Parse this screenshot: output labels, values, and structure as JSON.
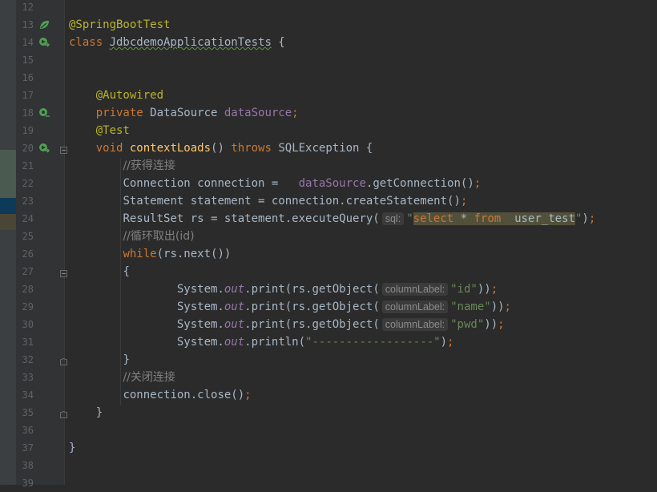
{
  "editor": {
    "lines": [
      {
        "num": "12",
        "tokens": []
      },
      {
        "num": "13",
        "gutter": "spring-bean-icon",
        "tokens": [
          {
            "t": "@SpringBootTest",
            "c": "ann"
          }
        ]
      },
      {
        "num": "14",
        "gutter": "run-test-class-icon",
        "tokens": [
          {
            "t": "class ",
            "c": "kw"
          },
          {
            "t": "JdbcdemoApplicationTests",
            "c": "squig"
          },
          {
            "t": " {",
            "c": "pl"
          }
        ]
      },
      {
        "num": "15",
        "tokens": []
      },
      {
        "num": "16",
        "tokens": []
      },
      {
        "num": "17",
        "tokens": [
          {
            "t": "    "
          },
          {
            "t": "@Autowired",
            "c": "ann"
          }
        ]
      },
      {
        "num": "18",
        "gutter": "autowired-bean-icon",
        "tokens": [
          {
            "t": "    "
          },
          {
            "t": "private ",
            "c": "kw"
          },
          {
            "t": "DataSource ",
            "c": "pl"
          },
          {
            "t": "dataSource",
            "c": "fld"
          },
          {
            "t": ";",
            "c": "kw"
          }
        ]
      },
      {
        "num": "19",
        "tokens": [
          {
            "t": "    "
          },
          {
            "t": "@Test",
            "c": "ann"
          }
        ]
      },
      {
        "num": "20",
        "gutter": "run-test-method-icon",
        "fold": "open",
        "tokens": [
          {
            "t": "    "
          },
          {
            "t": "void ",
            "c": "kw"
          },
          {
            "t": "contextLoads",
            "c": "fn"
          },
          {
            "t": "() ",
            "c": "pl"
          },
          {
            "t": "throws ",
            "c": "kw"
          },
          {
            "t": "SQLException {",
            "c": "pl"
          }
        ]
      },
      {
        "num": "21",
        "tokens": [
          {
            "t": "        "
          },
          {
            "t": "//获得连接",
            "c": "cmt"
          }
        ]
      },
      {
        "num": "22",
        "tokens": [
          {
            "t": "        "
          },
          {
            "t": "Connection connection =   ",
            "c": "pl"
          },
          {
            "t": "dataSource",
            "c": "fld"
          },
          {
            "t": ".getConnection()",
            "c": "pl"
          },
          {
            "t": ";",
            "c": "kw"
          }
        ]
      },
      {
        "num": "23",
        "tokens": [
          {
            "t": "        "
          },
          {
            "t": "Statement statement = connection.createStatement()",
            "c": "pl"
          },
          {
            "t": ";",
            "c": "kw"
          }
        ]
      },
      {
        "num": "24",
        "tokens": [
          {
            "t": "        "
          },
          {
            "t": "ResultSet rs = statement.executeQuery(",
            "c": "pl"
          },
          {
            "hint": "sql:"
          },
          {
            "t": "\"",
            "c": "str"
          },
          {
            "t": "select",
            "c": "kw",
            "hl": true
          },
          {
            "t": " * ",
            "c": "pl",
            "hl": true
          },
          {
            "t": "from",
            "c": "kw",
            "hl": true
          },
          {
            "t": "  user_test",
            "c": "pl",
            "hl": true
          },
          {
            "t": "\"",
            "c": "str"
          },
          {
            "t": ")",
            "c": "pl"
          },
          {
            "t": ";",
            "c": "kw"
          }
        ]
      },
      {
        "num": "25",
        "tokens": [
          {
            "t": "        "
          },
          {
            "t": "//循环取出(id)",
            "c": "cmt"
          }
        ]
      },
      {
        "num": "26",
        "tokens": [
          {
            "t": "        "
          },
          {
            "t": "while",
            "c": "kw"
          },
          {
            "t": "(rs.next())",
            "c": "pl"
          }
        ]
      },
      {
        "num": "27",
        "fold": "open",
        "tokens": [
          {
            "t": "        "
          },
          {
            "t": "{",
            "c": "pl"
          }
        ]
      },
      {
        "num": "28",
        "tokens": [
          {
            "t": "                "
          },
          {
            "t": "System.",
            "c": "pl"
          },
          {
            "t": "out",
            "c": "fldi"
          },
          {
            "t": ".print(rs.getObject(",
            "c": "pl"
          },
          {
            "hint": "columnLabel:"
          },
          {
            "t": "\"id\"",
            "c": "str"
          },
          {
            "t": "))",
            "c": "pl"
          },
          {
            "t": ";",
            "c": "kw"
          }
        ]
      },
      {
        "num": "29",
        "tokens": [
          {
            "t": "                "
          },
          {
            "t": "System.",
            "c": "pl"
          },
          {
            "t": "out",
            "c": "fldi"
          },
          {
            "t": ".print(rs.getObject(",
            "c": "pl"
          },
          {
            "hint": "columnLabel:"
          },
          {
            "t": "\"name\"",
            "c": "str"
          },
          {
            "t": "))",
            "c": "pl"
          },
          {
            "t": ";",
            "c": "kw"
          }
        ]
      },
      {
        "num": "30",
        "tokens": [
          {
            "t": "                "
          },
          {
            "t": "System.",
            "c": "pl"
          },
          {
            "t": "out",
            "c": "fldi"
          },
          {
            "t": ".print(rs.getObject(",
            "c": "pl"
          },
          {
            "hint": "columnLabel:"
          },
          {
            "t": "\"pwd\"",
            "c": "str"
          },
          {
            "t": "))",
            "c": "pl"
          },
          {
            "t": ";",
            "c": "kw"
          }
        ]
      },
      {
        "num": "31",
        "tokens": [
          {
            "t": "                "
          },
          {
            "t": "System.",
            "c": "pl"
          },
          {
            "t": "out",
            "c": "fldi"
          },
          {
            "t": ".println(",
            "c": "pl"
          },
          {
            "t": "\"------------------\"",
            "c": "str"
          },
          {
            "t": ")",
            "c": "pl"
          },
          {
            "t": ";",
            "c": "kw"
          }
        ]
      },
      {
        "num": "32",
        "fold": "close",
        "tokens": [
          {
            "t": "        "
          },
          {
            "t": "}",
            "c": "pl"
          }
        ]
      },
      {
        "num": "33",
        "tokens": [
          {
            "t": "        "
          },
          {
            "t": "//关闭连接",
            "c": "cmt"
          }
        ]
      },
      {
        "num": "34",
        "tokens": [
          {
            "t": "        "
          },
          {
            "t": "connection.close()",
            "c": "pl"
          },
          {
            "t": ";",
            "c": "kw"
          }
        ]
      },
      {
        "num": "35",
        "fold": "close",
        "tokens": [
          {
            "t": "    "
          },
          {
            "t": "}",
            "c": "pl"
          }
        ]
      },
      {
        "num": "36",
        "tokens": []
      },
      {
        "num": "37",
        "tokens": [
          {
            "t": "}",
            "c": "pl"
          }
        ]
      },
      {
        "num": "38",
        "tokens": []
      },
      {
        "num": "39",
        "tokens": []
      }
    ]
  },
  "colors": {
    "background": "#2b2b2b",
    "gutter": "#313335",
    "keyword": "#cc7832",
    "annotation": "#bbb529",
    "field": "#9876aa",
    "string": "#6a8759",
    "comment": "#808080",
    "method": "#ffc66d",
    "plain": "#a9b7c6",
    "gutter_icon": "#4fa052"
  }
}
